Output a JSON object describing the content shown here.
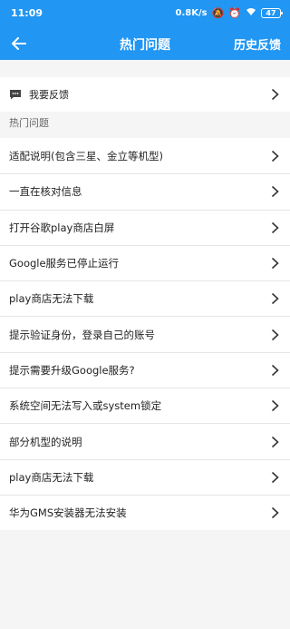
{
  "status_bar": {
    "time": "11:09",
    "speed": "0.8K/s",
    "battery": "47"
  },
  "app_bar": {
    "title": "热门问题",
    "history_label": "历史反馈"
  },
  "feedback": {
    "label": "我要反馈"
  },
  "section": {
    "label": "热门问题"
  },
  "items": [
    "适配说明(包含三星、金立等机型)",
    "一直在核对信息",
    "打开谷歌play商店白屏",
    "Google服务已停止运行",
    "play商店无法下载",
    "提示验证身份，登录自己的账号",
    "提示需要升级Google服务?",
    "系统空间无法写入或system锁定",
    "部分机型的说明",
    "play商店无法下载",
    "华为GMS安装器无法安装"
  ],
  "colors": {
    "accent": "#2196f3"
  }
}
